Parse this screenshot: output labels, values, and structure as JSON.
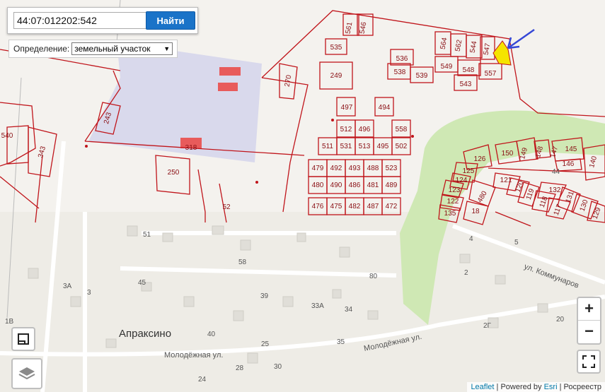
{
  "search": {
    "value": "44:07:012202:542",
    "button": "Найти"
  },
  "mode": {
    "label": "Определение:",
    "selected": "земельный участок"
  },
  "colors": {
    "parcel_line": "#c0151b",
    "highlight": "#f5e400",
    "arrow": "#3547d6",
    "button": "#1a73c8"
  },
  "parcels": [
    "561",
    "546",
    "535",
    "564",
    "562",
    "544",
    "547",
    "536",
    "538",
    "539",
    "549",
    "548",
    "557",
    "543",
    "249",
    "270",
    "497",
    "494",
    "512",
    "496",
    "558",
    "511",
    "531",
    "513",
    "495",
    "502",
    "479",
    "492",
    "493",
    "488",
    "523",
    "480",
    "490",
    "486",
    "481",
    "489",
    "476",
    "475",
    "482",
    "487",
    "472",
    "243",
    "318",
    "250",
    "343",
    "540",
    "52",
    "126",
    "150",
    "149",
    "148",
    "147",
    "145",
    "125",
    "146",
    "140",
    "124",
    "121",
    "120",
    "119",
    "132",
    "131",
    "123",
    "480",
    "118",
    "117",
    "130",
    "129",
    "122",
    "135",
    "18"
  ],
  "map_labels": {
    "village": "Апраксино",
    "street1": "ул. Коммунаров",
    "street2": "Молодёжная ул.",
    "street3": "Молодёжная ул.",
    "houses": [
      "51",
      "58",
      "45",
      "3A",
      "3",
      "39",
      "33A",
      "34",
      "80",
      "40",
      "25",
      "35",
      "28",
      "30",
      "24",
      "1B",
      "4",
      "5",
      "2",
      "2Г",
      "20",
      "44"
    ]
  },
  "zoom": {
    "in": "+",
    "out": "−"
  },
  "attribution": {
    "leaflet": "Leaflet",
    "sep1": " | Powered by ",
    "esri": "Esri",
    "sep2": " | Росреестр"
  },
  "icons": [
    "fullscreen-icon",
    "layers-icon",
    "legend-icon",
    "arrow-annotation-icon"
  ]
}
